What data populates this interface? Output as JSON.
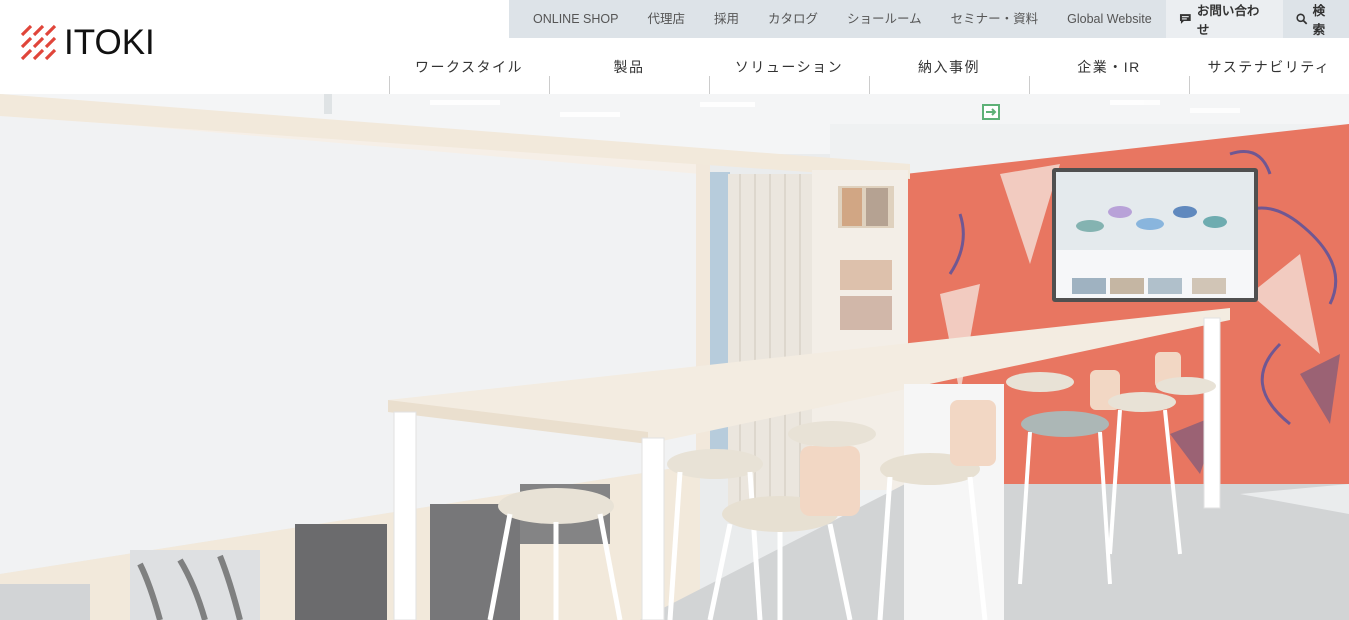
{
  "brand": {
    "name": "ITOKI",
    "accent": "#e0453a"
  },
  "utility_nav": {
    "items": [
      "ONLINE SHOP",
      "代理店",
      "採用",
      "カタログ",
      "ショールーム",
      "セミナー・資料",
      "Global Website"
    ],
    "contact_label": "お問い合わせ",
    "search_label": "検索"
  },
  "main_nav": {
    "items": [
      "ワークスタイル",
      "製品",
      "ソリューション",
      "納入事例",
      "企業・IR",
      "サステナビリティ"
    ]
  },
  "hero": {
    "description_icon": "office-lounge-photo",
    "colors": {
      "mural": "#e3583f",
      "panel": "#eef0f1",
      "table": "#efe7dc"
    }
  }
}
